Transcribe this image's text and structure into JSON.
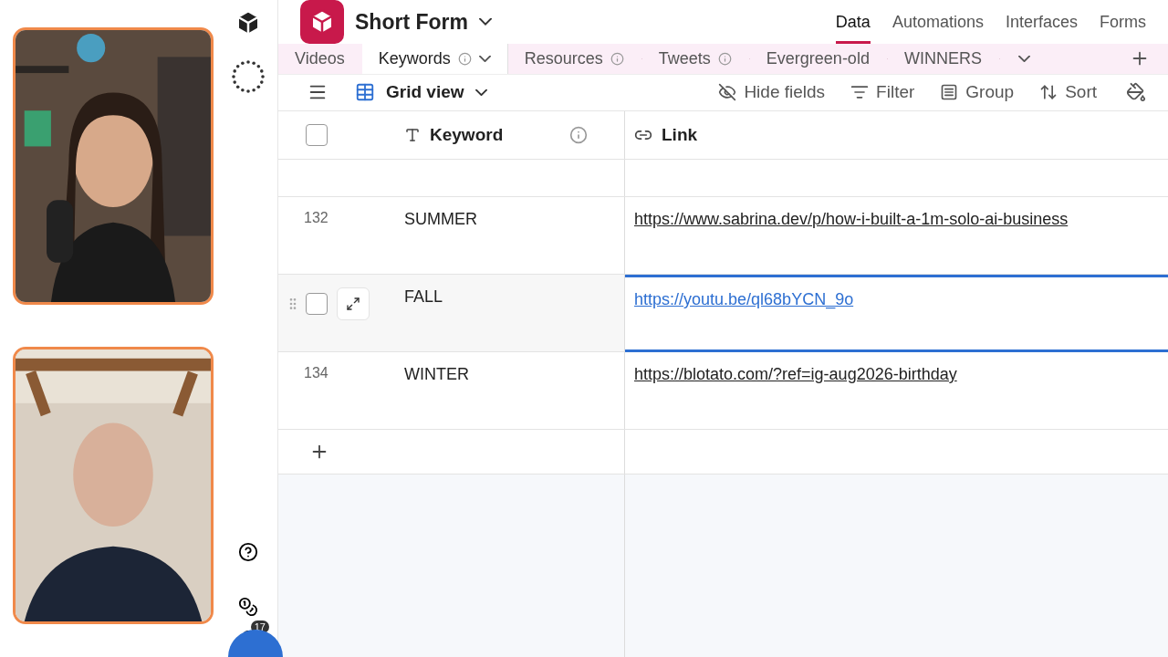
{
  "sidebar": {
    "notification_count": "17"
  },
  "base": {
    "title": "Short Form"
  },
  "nav": [
    {
      "label": "Data",
      "selected": true
    },
    {
      "label": "Automations",
      "selected": false
    },
    {
      "label": "Interfaces",
      "selected": false
    },
    {
      "label": "Forms",
      "selected": false
    }
  ],
  "table_tabs": [
    {
      "label": "Videos",
      "selected": false,
      "info": false,
      "menu": false
    },
    {
      "label": "Keywords",
      "selected": true,
      "info": true,
      "menu": true
    },
    {
      "label": "Resources",
      "selected": false,
      "info": true,
      "menu": false
    },
    {
      "label": "Tweets",
      "selected": false,
      "info": true,
      "menu": false
    },
    {
      "label": "Evergreen-old",
      "selected": false,
      "info": false,
      "menu": false
    },
    {
      "label": "WINNERS",
      "selected": false,
      "info": false,
      "menu": false
    }
  ],
  "view": {
    "label": "Grid view"
  },
  "toolbar": [
    {
      "kind": "hide",
      "label": "Hide fields"
    },
    {
      "kind": "filter",
      "label": "Filter"
    },
    {
      "kind": "group",
      "label": "Group"
    },
    {
      "kind": "sort",
      "label": "Sort"
    }
  ],
  "select_all": {
    "checked": false
  },
  "columns": [
    {
      "kind": "text",
      "label": "Keyword",
      "info": true
    },
    {
      "kind": "link",
      "label": "Link"
    }
  ],
  "rows": [
    {
      "number": "132",
      "keyword": "SUMMER",
      "link": "https://www.sabrina.dev/p/how-i-built-a-1m-solo-ai-business",
      "hovered": false
    },
    {
      "checked": false,
      "keyword": "FALL",
      "link": "https://youtu.be/ql68bYCN_9o",
      "hovered": true
    },
    {
      "number": "134",
      "keyword": "WINTER",
      "link": "https://blotato.com/?ref=ig-aug2026-birthday",
      "hovered": false
    }
  ]
}
